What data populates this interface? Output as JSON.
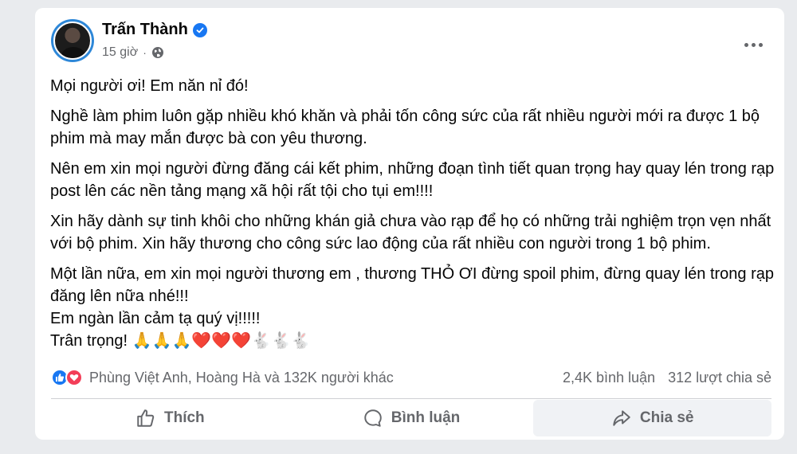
{
  "post": {
    "author": "Trấn Thành",
    "time": "15 giờ",
    "separator": "·",
    "paragraphs": [
      "Mọi người ơi! Em năn nỉ đó!",
      "Nghề làm phim luôn gặp nhiều khó khăn và phải tốn công sức của rất nhiều người mới ra được 1 bộ phim mà may mắn được bà con yêu thương.",
      "Nên em xin mọi người đừng đăng cái kết phim, những đoạn tình tiết quan trọng hay quay lén trong rạp post lên các nền tảng mạng xã hội rất tội cho tụi em!!!!",
      "Xin hãy dành sự tinh khôi cho những khán giả chưa vào rạp để họ có những trải nghiệm trọn vẹn nhất với bộ phim. Xin hãy thương cho công sức lao động của rất nhiều con người trong 1 bộ phim."
    ],
    "closing_lines": [
      "Một lần nữa, em xin mọi người thương em , thương THỎ ƠI đừng spoil phim, đừng quay lén trong rạp đăng lên nữa nhé!!!",
      "Em ngàn lần cảm tạ quý vị!!!!!",
      "Trân trọng! 🙏🙏🙏❤️❤️❤️🐇🐇🐇"
    ]
  },
  "stats": {
    "reactors": "Phùng Việt Anh, Hoàng Hà và 132K người khác",
    "comments": "2,4K bình luận",
    "shares": "312 lượt chia sẻ"
  },
  "actions": {
    "like": "Thích",
    "comment": "Bình luận",
    "share": "Chia sẻ"
  },
  "colors": {
    "accent": "#1877f2",
    "love": "#f33e58",
    "muted_text": "#65676b"
  },
  "icons": [
    "verified-icon",
    "globe-icon",
    "more-icon",
    "like-icon",
    "comment-icon",
    "share-icon"
  ]
}
